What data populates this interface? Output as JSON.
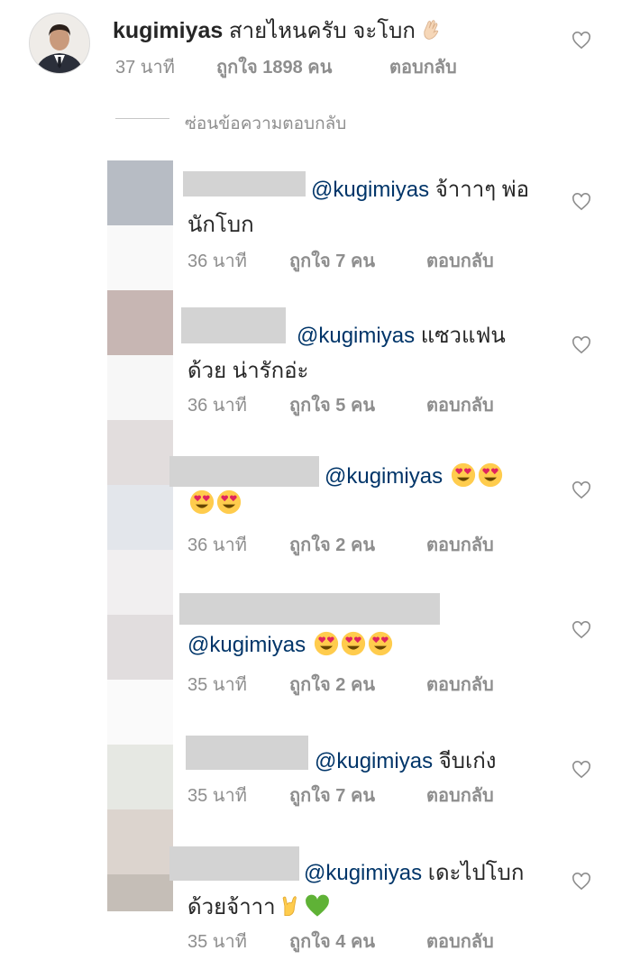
{
  "main_comment": {
    "username": "kugimiyas",
    "text": "สายไหนครับ จะโบก",
    "time": "37 นาที",
    "likes": "ถูกใจ 1898 คน",
    "reply": "ตอบกลับ"
  },
  "hide_replies": "ซ่อนข้อความตอบกลับ",
  "replies": [
    {
      "mention": "@kugimiyas",
      "line1_rest": "จ้าาาๆ พ่อ",
      "line2": "นักโบก",
      "time": "36 นาที",
      "likes": "ถูกใจ 7 คน",
      "reply": "ตอบกลับ"
    },
    {
      "mention": "@kugimiyas",
      "line1_rest": "แซวแฟน",
      "line2": "ด้วย น่ารักอ่ะ",
      "time": "36 นาที",
      "likes": "ถูกใจ 5 คน",
      "reply": "ตอบกลับ"
    },
    {
      "mention": "@kugimiyas",
      "time": "36 นาที",
      "likes": "ถูกใจ 2 คน",
      "reply": "ตอบกลับ"
    },
    {
      "mention": "@kugimiyas",
      "time": "35 นาที",
      "likes": "ถูกใจ 2 คน",
      "reply": "ตอบกลับ"
    },
    {
      "mention": "@kugimiyas",
      "line1_rest": "จีบเก่ง",
      "time": "35 นาที",
      "likes": "ถูกใจ 7 คน",
      "reply": "ตอบกลับ"
    },
    {
      "mention": "@kugimiyas",
      "line1_rest": "เดะไปโบก",
      "line2": "ด้วยจ้าาา",
      "time": "35 นาที",
      "likes": "ถูกใจ 4 คน",
      "reply": "ตอบกลับ"
    }
  ],
  "icons": {
    "like": "heart-outline-icon",
    "heart_eyes": "heart-eyes-emoji",
    "wave": "waving-hand-emoji",
    "rock": "rock-on-hand-emoji",
    "green_heart": "green-heart-emoji"
  },
  "colors": {
    "text": "#262626",
    "meta": "#8e8e8e",
    "mention": "#003569",
    "redaction": "#d3d3d3"
  }
}
